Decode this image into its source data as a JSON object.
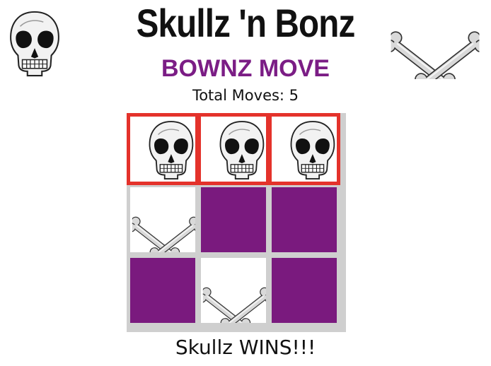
{
  "header": {
    "title": "Skullz 'n Bonz",
    "left_icon": "skull-icon",
    "right_icon": "crossbones-icon"
  },
  "status": {
    "turn": "BOWNZ MOVE",
    "moves": "Total Moves: 5"
  },
  "board": {
    "cells": [
      "skull",
      "skull",
      "skull",
      "bones",
      "empty",
      "empty",
      "empty",
      "bones",
      "empty"
    ],
    "winning_cells": [
      0,
      1,
      2
    ]
  },
  "result": "Skullz WINS!!!",
  "colors": {
    "accent": "#7b1d85",
    "empty_cell": "#7a1a7e",
    "win_border": "#e4322b",
    "board_bg": "#cfcfcf"
  }
}
